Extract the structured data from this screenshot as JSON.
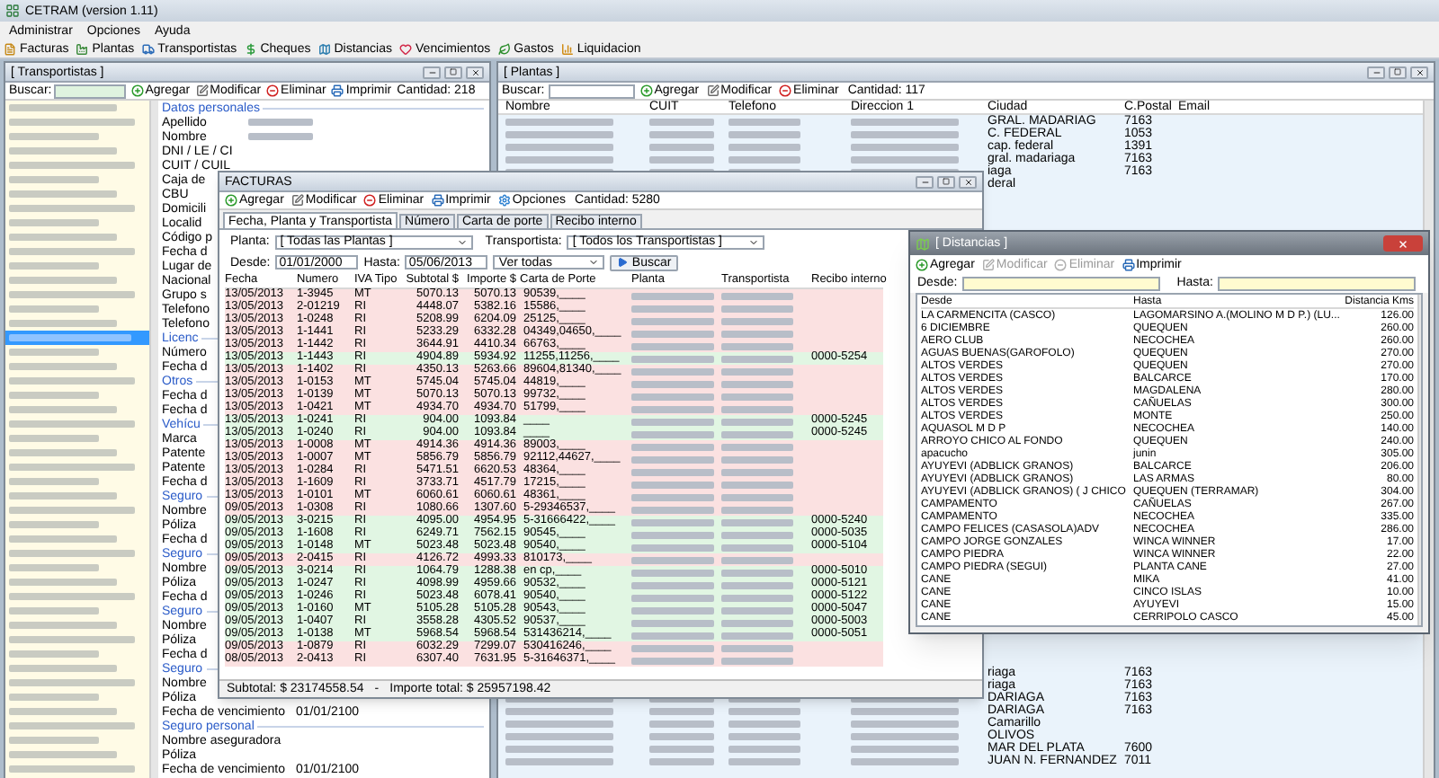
{
  "app": {
    "title": "CETRAM (version 1.11)",
    "menu": [
      "Administrar",
      "Opciones",
      "Ayuda"
    ],
    "toolbar": [
      "Facturas",
      "Plantas",
      "Transportistas",
      "Cheques",
      "Distancias",
      "Vencimientos",
      "Gastos",
      "Liquidacion"
    ]
  },
  "transportistas": {
    "title": "[ Transportistas ]",
    "search_label": "Buscar:",
    "actions": [
      "Agregar",
      "Modificar",
      "Eliminar",
      "Imprimir"
    ],
    "count": "Cantidad: 218",
    "list": [
      {
        "selected": false
      },
      {
        "selected": false
      },
      {
        "selected": false
      },
      {
        "selected": false
      },
      {
        "selected": false
      },
      {
        "selected": false
      },
      {
        "selected": false
      },
      {
        "selected": false
      },
      {
        "selected": false
      },
      {
        "selected": false
      },
      {
        "selected": false
      },
      {
        "selected": false
      },
      {
        "selected": false
      },
      {
        "selected": false
      },
      {
        "selected": false
      },
      {
        "selected": false
      },
      {
        "selected": true
      },
      {
        "selected": false
      },
      {
        "selected": false
      },
      {
        "selected": false
      },
      {
        "selected": false
      },
      {
        "selected": false
      },
      {
        "selected": false
      },
      {
        "selected": false
      },
      {
        "selected": false
      },
      {
        "selected": false
      },
      {
        "selected": false
      },
      {
        "selected": false
      },
      {
        "selected": false
      },
      {
        "selected": false
      },
      {
        "selected": false
      },
      {
        "selected": false
      },
      {
        "selected": false
      },
      {
        "selected": false
      },
      {
        "selected": false
      },
      {
        "selected": false
      },
      {
        "selected": false
      },
      {
        "selected": false
      },
      {
        "selected": false
      },
      {
        "selected": false
      },
      {
        "selected": false
      },
      {
        "selected": false
      },
      {
        "selected": false
      },
      {
        "selected": false
      },
      {
        "selected": false
      },
      {
        "selected": false
      },
      {
        "selected": false
      }
    ],
    "details": [
      {
        "kind": "section",
        "label": "Datos personales"
      },
      {
        "kind": "masked_field",
        "label": "Apellido"
      },
      {
        "kind": "masked_field",
        "label": "Nombre"
      },
      {
        "kind": "field",
        "label": "DNI / LE / CI"
      },
      {
        "kind": "field",
        "label": "CUIT / CUIL"
      },
      {
        "kind": "field",
        "label": "Caja de"
      },
      {
        "kind": "field",
        "label": "CBU"
      },
      {
        "kind": "field",
        "label": "Domicili"
      },
      {
        "kind": "field",
        "label": "Localid"
      },
      {
        "kind": "field",
        "label": "Código p"
      },
      {
        "kind": "field",
        "label": "Fecha d"
      },
      {
        "kind": "field",
        "label": "Lugar de"
      },
      {
        "kind": "field",
        "label": "Nacional"
      },
      {
        "kind": "field",
        "label": "Grupo s"
      },
      {
        "kind": "field",
        "label": "Telefono"
      },
      {
        "kind": "field",
        "label": "Telefono"
      },
      {
        "kind": "section",
        "label": "Licenc"
      },
      {
        "kind": "field",
        "label": "Número"
      },
      {
        "kind": "field",
        "label": "Fecha d"
      },
      {
        "kind": "section",
        "label": "Otros"
      },
      {
        "kind": "field",
        "label": "Fecha d"
      },
      {
        "kind": "field",
        "label": "Fecha d"
      },
      {
        "kind": "section",
        "label": "Vehícu"
      },
      {
        "kind": "field",
        "label": "Marca"
      },
      {
        "kind": "field",
        "label": "Patente"
      },
      {
        "kind": "field",
        "label": "Patente"
      },
      {
        "kind": "field",
        "label": "Fecha d"
      },
      {
        "kind": "section",
        "label": "Seguro"
      },
      {
        "kind": "field",
        "label": "Nombre"
      },
      {
        "kind": "field",
        "label": "Póliza"
      },
      {
        "kind": "field",
        "label": "Fecha d"
      },
      {
        "kind": "section",
        "label": "Seguro"
      },
      {
        "kind": "field",
        "label": "Nombre"
      },
      {
        "kind": "field",
        "label": "Póliza"
      },
      {
        "kind": "field",
        "label": "Fecha d"
      },
      {
        "kind": "section",
        "label": "Seguro"
      },
      {
        "kind": "field",
        "label": "Nombre"
      },
      {
        "kind": "field",
        "label": "Póliza"
      },
      {
        "kind": "field",
        "label": "Fecha d"
      },
      {
        "kind": "section",
        "label": "Seguro"
      },
      {
        "kind": "field",
        "label": "Nombre"
      },
      {
        "kind": "field",
        "label": "Póliza"
      },
      {
        "kind": "field",
        "label": "Fecha de vencimiento",
        "value": "01/01/2100"
      },
      {
        "kind": "section",
        "label": "Seguro personal"
      },
      {
        "kind": "field",
        "label": "Nombre aseguradora"
      },
      {
        "kind": "field",
        "label": "Póliza"
      },
      {
        "kind": "field",
        "label": "Fecha de vencimiento",
        "value": "01/01/2100"
      }
    ]
  },
  "plantas": {
    "title": "[ Plantas ]",
    "search_label": "Buscar:",
    "actions": [
      "Agregar",
      "Modificar",
      "Eliminar"
    ],
    "count": "Cantidad: 117",
    "columns": [
      "Nombre",
      "CUIT",
      "Telefono",
      "Direccion 1",
      "Ciudad",
      "C.Postal",
      "Email"
    ],
    "top_rows": [
      {
        "ciudad": "GRAL. MADARIAG",
        "cp": "7163"
      },
      {
        "ciudad": "C. FEDERAL",
        "cp": "1053"
      },
      {
        "ciudad": "cap. federal",
        "cp": "1391"
      },
      {
        "ciudad": "gral. madariaga",
        "cp": "7163"
      },
      {
        "ciudad": "iaga",
        "cp": "7163"
      },
      {
        "ciudad": "deral"
      }
    ],
    "bottom_rows": [
      {
        "ciudad": "riaga",
        "cp": "7163"
      },
      {
        "ciudad": "riaga",
        "cp": "7163"
      },
      {
        "ciudad": "DARIAGA",
        "cp": "7163"
      },
      {
        "ciudad": "DARIAGA",
        "cp": "7163"
      },
      {
        "ciudad": "Camarillo"
      },
      {
        "ciudad": "OLIVOS"
      },
      {
        "ciudad": "MAR DEL PLATA",
        "cp": "7600"
      },
      {
        "ciudad": "JUAN N. FERNANDEZ",
        "cp": "7011"
      }
    ]
  },
  "facturas": {
    "title": "FACTURAS",
    "actions": [
      "Agregar",
      "Modificar",
      "Eliminar",
      "Imprimir",
      "Opciones"
    ],
    "count": "Cantidad: 5280",
    "tabs": [
      {
        "label": "Fecha, Planta y Transportista",
        "selected": true
      },
      {
        "label": "Número",
        "selected": false
      },
      {
        "label": "Carta de porte",
        "selected": false
      },
      {
        "label": "Recibo interno",
        "selected": false
      }
    ],
    "filters": {
      "planta_label": "Planta:",
      "planta": "[ Todas las Plantas ]",
      "transportista_label": "Transportista:",
      "transportista": "[ Todos los Transportistas ]",
      "desde_label": "Desde:",
      "desde": "01/01/2000",
      "hasta_label": "Hasta:",
      "hasta": "05/06/2013",
      "ver": "Ver todas",
      "buscar": "Buscar"
    },
    "columns": [
      "Fecha",
      "Numero",
      "IVA Tipo",
      "Subtotal $",
      "Importe $",
      "Carta de Porte",
      "Planta",
      "Transportista",
      "Recibo interno"
    ],
    "rows": [
      {
        "fecha": "13/05/2013",
        "numero": "1-3945",
        "iva": "MT",
        "subtotal": "5070.13",
        "importe": "5070.13",
        "carta": "90539,____",
        "color": "#fbe1e1"
      },
      {
        "fecha": "13/05/2013",
        "numero": "2-01219",
        "iva": "RI",
        "subtotal": "4448.07",
        "importe": "5382.16",
        "carta": "15586,____",
        "color": "#fbe1e1"
      },
      {
        "fecha": "13/05/2013",
        "numero": "1-0248",
        "iva": "RI",
        "subtotal": "5208.99",
        "importe": "6204.09",
        "carta": "25125,____",
        "color": "#fbe1e1"
      },
      {
        "fecha": "13/05/2013",
        "numero": "1-1441",
        "iva": "RI",
        "subtotal": "5233.29",
        "importe": "6332.28",
        "carta": "04349,04650,____",
        "color": "#fbe1e1"
      },
      {
        "fecha": "13/05/2013",
        "numero": "1-1442",
        "iva": "RI",
        "subtotal": "3644.91",
        "importe": "4410.34",
        "carta": "66763,____",
        "color": "#fbe1e1"
      },
      {
        "fecha": "13/05/2013",
        "numero": "1-1443",
        "iva": "RI",
        "subtotal": "4904.89",
        "importe": "5934.92",
        "carta": "11255,11256,____",
        "recibo": "0000-5254",
        "color": "#e1f6e3"
      },
      {
        "fecha": "13/05/2013",
        "numero": "1-1402",
        "iva": "RI",
        "subtotal": "4350.13",
        "importe": "5263.66",
        "carta": "89604,81340,____",
        "color": "#fbe1e1"
      },
      {
        "fecha": "13/05/2013",
        "numero": "1-0153",
        "iva": "MT",
        "subtotal": "5745.04",
        "importe": "5745.04",
        "carta": "44819,____",
        "color": "#fbe1e1"
      },
      {
        "fecha": "13/05/2013",
        "numero": "1-0139",
        "iva": "MT",
        "subtotal": "5070.13",
        "importe": "5070.13",
        "carta": "99732,____",
        "color": "#fbe1e1"
      },
      {
        "fecha": "13/05/2013",
        "numero": "1-0421",
        "iva": "MT",
        "subtotal": "4934.70",
        "importe": "4934.70",
        "carta": "51799,____",
        "color": "#fbe1e1"
      },
      {
        "fecha": "13/05/2013",
        "numero": "1-0241",
        "iva": "RI",
        "subtotal": "904.00",
        "importe": "1093.84",
        "carta": "____",
        "recibo": "0000-5245",
        "color": "#e1f6e3"
      },
      {
        "fecha": "13/05/2013",
        "numero": "1-0240",
        "iva": "RI",
        "subtotal": "904.00",
        "importe": "1093.84",
        "carta": "____",
        "recibo": "0000-5245",
        "color": "#e1f6e3"
      },
      {
        "fecha": "13/05/2013",
        "numero": "1-0008",
        "iva": "MT",
        "subtotal": "4914.36",
        "importe": "4914.36",
        "carta": "89003,____",
        "color": "#fbe1e1"
      },
      {
        "fecha": "13/05/2013",
        "numero": "1-0007",
        "iva": "MT",
        "subtotal": "5856.79",
        "importe": "5856.79",
        "carta": "92112,44627,____",
        "color": "#fbe1e1"
      },
      {
        "fecha": "13/05/2013",
        "numero": "1-0284",
        "iva": "RI",
        "subtotal": "5471.51",
        "importe": "6620.53",
        "carta": "48364,____",
        "color": "#fbe1e1"
      },
      {
        "fecha": "13/05/2013",
        "numero": "1-1609",
        "iva": "RI",
        "subtotal": "3733.71",
        "importe": "4517.79",
        "carta": "17215,____",
        "color": "#fbe1e1"
      },
      {
        "fecha": "13/05/2013",
        "numero": "1-0101",
        "iva": "MT",
        "subtotal": "6060.61",
        "importe": "6060.61",
        "carta": "48361,____",
        "color": "#fbe1e1"
      },
      {
        "fecha": "09/05/2013",
        "numero": "1-0308",
        "iva": "RI",
        "subtotal": "1080.66",
        "importe": "1307.60",
        "carta": "5-29346537,____",
        "color": "#fbe1e1"
      },
      {
        "fecha": "09/05/2013",
        "numero": "3-0215",
        "iva": "RI",
        "subtotal": "4095.00",
        "importe": "4954.95",
        "carta": "5-31666422,____",
        "recibo": "0000-5240",
        "color": "#e1f6e3"
      },
      {
        "fecha": "09/05/2013",
        "numero": "1-1608",
        "iva": "RI",
        "subtotal": "6249.71",
        "importe": "7562.15",
        "carta": "90545,____",
        "recibo": "0000-5035",
        "color": "#e1f6e3"
      },
      {
        "fecha": "09/05/2013",
        "numero": "1-0148",
        "iva": "MT",
        "subtotal": "5023.48",
        "importe": "5023.48",
        "carta": "90540,____",
        "recibo": "0000-5104",
        "color": "#e1f6e3"
      },
      {
        "fecha": "09/05/2013",
        "numero": "2-0415",
        "iva": "RI",
        "subtotal": "4126.72",
        "importe": "4993.33",
        "carta": "810173,____",
        "color": "#fbe1e1"
      },
      {
        "fecha": "09/05/2013",
        "numero": "3-0214",
        "iva": "RI",
        "subtotal": "1064.79",
        "importe": "1288.38",
        "carta": "en cp,____",
        "recibo": "0000-5010",
        "color": "#e1f6e3"
      },
      {
        "fecha": "09/05/2013",
        "numero": "1-0247",
        "iva": "RI",
        "subtotal": "4098.99",
        "importe": "4959.66",
        "carta": "90532,____",
        "recibo": "0000-5121",
        "color": "#e1f6e3"
      },
      {
        "fecha": "09/05/2013",
        "numero": "1-0246",
        "iva": "RI",
        "subtotal": "5023.48",
        "importe": "6078.41",
        "carta": "90540,____",
        "recibo": "0000-5122",
        "color": "#e1f6e3"
      },
      {
        "fecha": "09/05/2013",
        "numero": "1-0160",
        "iva": "MT",
        "subtotal": "5105.28",
        "importe": "5105.28",
        "carta": "90543,____",
        "recibo": "0000-5047",
        "color": "#e1f6e3"
      },
      {
        "fecha": "09/05/2013",
        "numero": "1-0407",
        "iva": "RI",
        "subtotal": "3558.28",
        "importe": "4305.52",
        "carta": "90537,____",
        "recibo": "0000-5003",
        "color": "#e1f6e3"
      },
      {
        "fecha": "09/05/2013",
        "numero": "1-0138",
        "iva": "MT",
        "subtotal": "5968.54",
        "importe": "5968.54",
        "carta": "531436214,____",
        "recibo": "0000-5051",
        "color": "#e1f6e3"
      },
      {
        "fecha": "09/05/2013",
        "numero": "1-0879",
        "iva": "RI",
        "subtotal": "6032.29",
        "importe": "7299.07",
        "carta": "530416246,____",
        "color": "#fbe1e1"
      },
      {
        "fecha": "08/05/2013",
        "numero": "2-0413",
        "iva": "RI",
        "subtotal": "6307.40",
        "importe": "7631.95",
        "carta": "5-31646371,____",
        "color": "#fbe1e1"
      }
    ],
    "subtotal": "Subtotal: $ 23174558.54",
    "separator": "-",
    "total": "Importe total: $ 25957198.42"
  },
  "distancias": {
    "title": "[ Distancias ]",
    "actions": [
      {
        "label": "Agregar",
        "disabled": false
      },
      {
        "label": "Modificar",
        "disabled": true
      },
      {
        "label": "Eliminar",
        "disabled": true
      },
      {
        "label": "Imprimir",
        "disabled": false
      }
    ],
    "desde_label": "Desde:",
    "hasta_label": "Hasta:",
    "columns": [
      "Desde",
      "Hasta",
      "Distancia Kms"
    ],
    "rows": [
      [
        "LA CARMENCITA (CASCO)",
        "LAGOMARSINO A.(MOLINO M D P.) (LU...",
        "126.00"
      ],
      [
        "6 DICIEMBRE",
        "QUEQUEN",
        "260.00"
      ],
      [
        "AERO CLUB",
        "NECOCHEA",
        "260.00"
      ],
      [
        "AGUAS BUENAS(GAROFOLO)",
        "QUEQUEN",
        "270.00"
      ],
      [
        "ALTOS VERDES",
        "QUEQUEN",
        "270.00"
      ],
      [
        "ALTOS VERDES",
        "BALCARCE",
        "170.00"
      ],
      [
        "ALTOS VERDES",
        "MAGDALENA",
        "280.00"
      ],
      [
        "ALTOS VERDES",
        "CAÑUELAS",
        "300.00"
      ],
      [
        "ALTOS VERDES",
        "MONTE",
        "250.00"
      ],
      [
        "AQUASOL M D P",
        "NECOCHEA",
        "140.00"
      ],
      [
        "ARROYO CHICO AL FONDO",
        "QUEQUEN",
        "240.00"
      ],
      [
        "apacucho",
        "junin",
        "305.00"
      ],
      [
        "AYUYEVI (ADBLICK GRANOS)",
        "BALCARCE",
        "206.00"
      ],
      [
        "AYUYEVI (ADBLICK GRANOS)",
        "LAS ARMAS",
        "80.00"
      ],
      [
        "AYUYEVI (ADBLICK GRANOS) ( J CHICO",
        "QUEQUEN (TERRAMAR)",
        "304.00"
      ],
      [
        "CAMPAMENTO",
        "CAÑUELAS",
        "267.00"
      ],
      [
        "CAMPAMENTO",
        "NECOCHEA",
        "335.00"
      ],
      [
        "CAMPO FELICES (CASASOLA)ADV",
        "NECOCHEA",
        "286.00"
      ],
      [
        "CAMPO JORGE GONZALES",
        "WINCA WINNER",
        "17.00"
      ],
      [
        "CAMPO PIEDRA",
        "WINCA WINNER",
        "22.00"
      ],
      [
        "CAMPO PIEDRA (SEGUI)",
        "PLANTA CANE",
        "27.00"
      ],
      [
        "CANE",
        "MIKA",
        "41.00"
      ],
      [
        "CANE",
        "CINCO ISLAS",
        "10.00"
      ],
      [
        "CANE",
        "AYUYEVI",
        "15.00"
      ],
      [
        "CANE",
        "CERRIPOLO CASCO",
        "45.00"
      ]
    ]
  }
}
